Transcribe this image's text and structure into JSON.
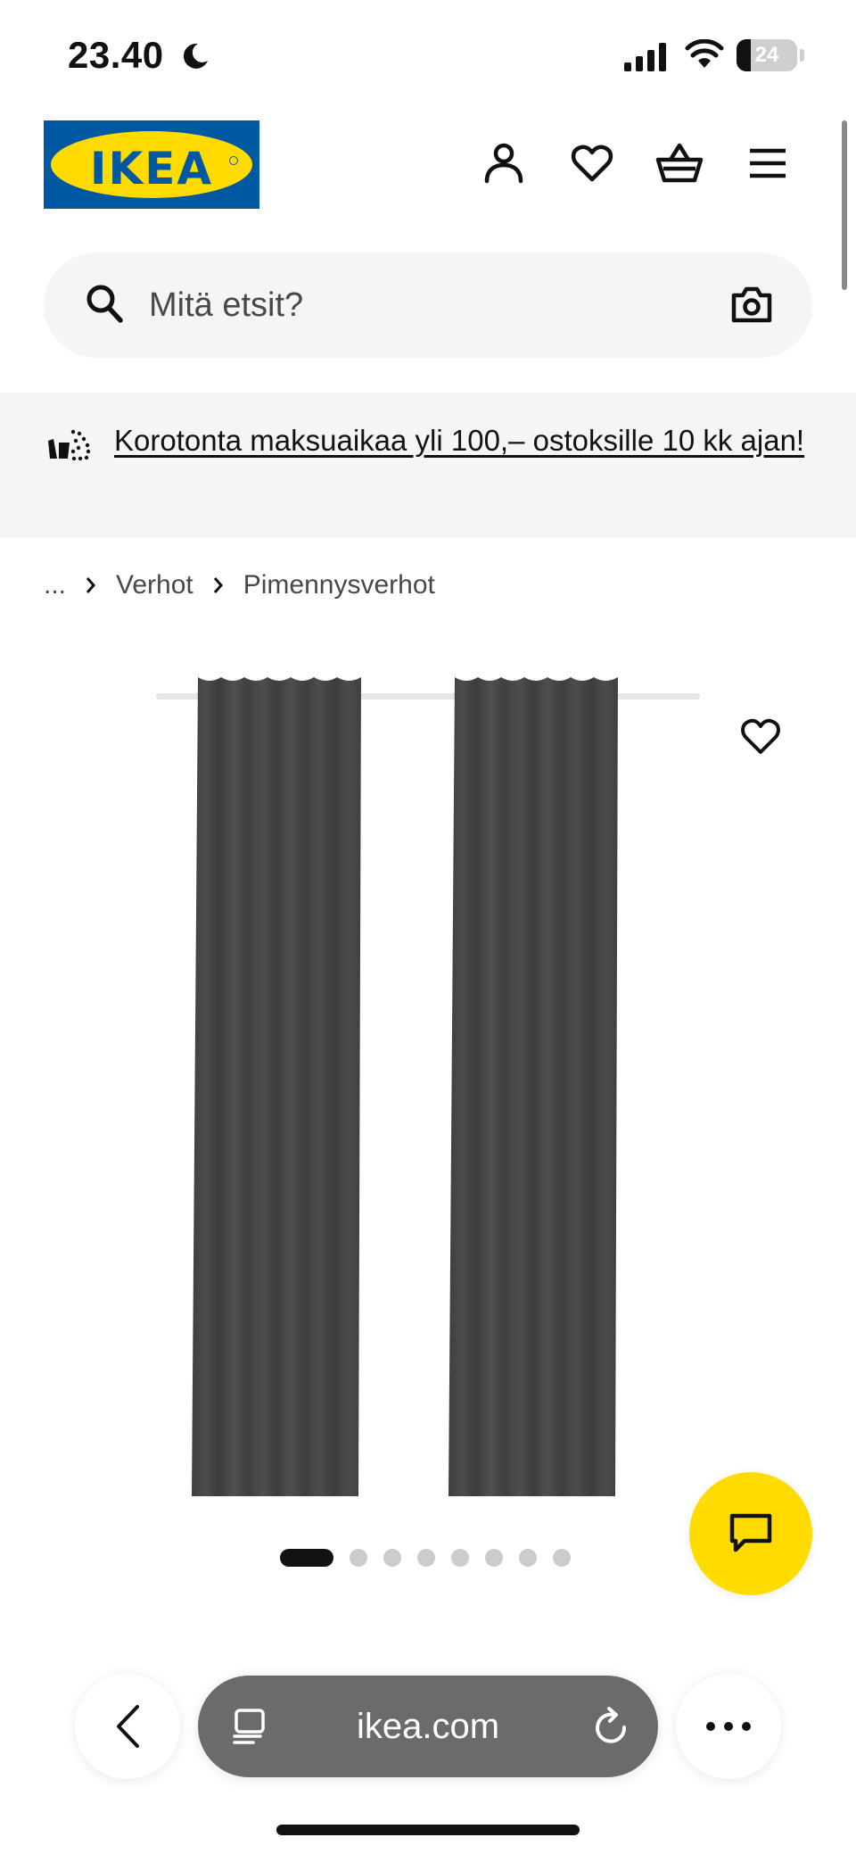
{
  "status_bar": {
    "time": "23.40",
    "battery": "24",
    "battery_level": 0.24
  },
  "header": {
    "logo_text": "IKEA",
    "icons": [
      "user-icon",
      "heart-icon",
      "basket-icon",
      "menu-icon"
    ]
  },
  "search": {
    "placeholder": "Mitä etsit?"
  },
  "promo": {
    "text": "Korotonta maksuaikaa yli 100,– ostoksille 10 kk ajan!"
  },
  "breadcrumb": {
    "ellipsis": "...",
    "items": [
      "Verhot",
      "Pimennysverhot"
    ]
  },
  "carousel": {
    "total": 8,
    "active_index": 0
  },
  "browser": {
    "url": "ikea.com"
  },
  "colors": {
    "ikea_blue": "#0058a3",
    "ikea_yellow": "#ffdb00",
    "curtain": "#4a4a4a",
    "banner_bg": "#f5f5f5"
  }
}
